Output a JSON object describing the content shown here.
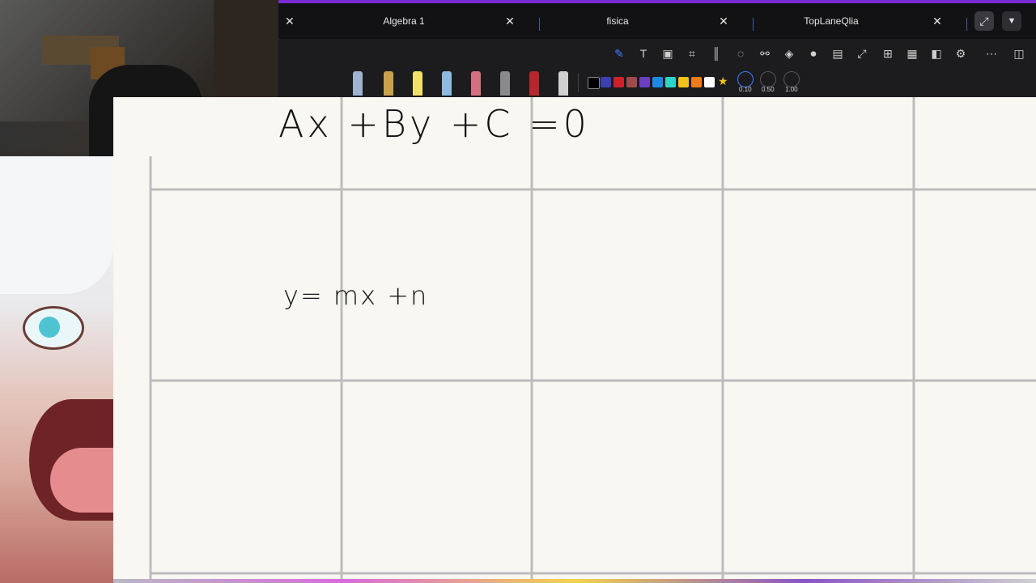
{
  "tabs": [
    {
      "label": "Algebra 1",
      "close": "✕"
    },
    {
      "label": "fisica",
      "close": "✕"
    },
    {
      "label": "TopLaneQlia",
      "close": "✕"
    }
  ],
  "window": {
    "close_label": "✕",
    "expand_icon": "⤢",
    "dropdown_icon": "▼"
  },
  "toolbar_icons": [
    "pen-icon",
    "text-box-icon",
    "image-icon",
    "crop-icon",
    "ruler-icon",
    "comment-icon",
    "link-icon",
    "layers-icon",
    "microphone-icon",
    "presentation-icon",
    "fullscreen-icon",
    "add-page-icon",
    "grid-icon",
    "split-view-icon",
    "settings-icon",
    "more-icon",
    "sidebar-icon"
  ],
  "pens": [
    "fountain-pen",
    "pencil",
    "highlighter",
    "marker",
    "eraser",
    "fine-liner",
    "brush-pen",
    "tape"
  ],
  "colors": [
    "#000000",
    "#3b3fb0",
    "#d0202a",
    "#a14a4a",
    "#6a3fc0",
    "#1e88e5",
    "#2bd6c6",
    "#f2c21b",
    "#f07b1b",
    "#ffffff"
  ],
  "favorite_icon": "★",
  "stroke_sizes": [
    "0.10",
    "0.50",
    "1.00"
  ],
  "canvas": {
    "line1": "Ax +By +C =0",
    "line2": "y= mx +n"
  }
}
